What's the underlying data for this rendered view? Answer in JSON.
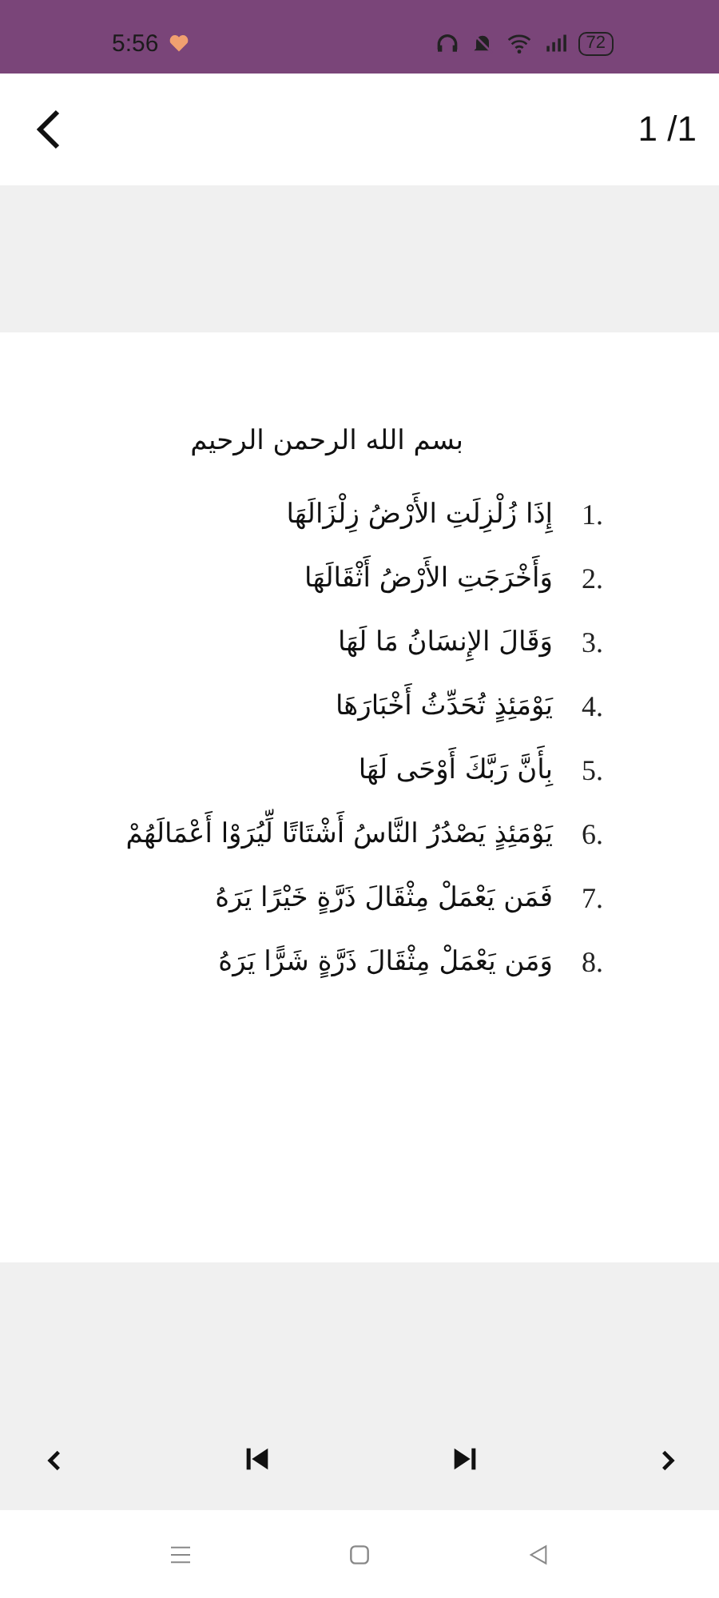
{
  "status_bar": {
    "time": "5:56",
    "battery": "72"
  },
  "header": {
    "page_indicator": "1 /1"
  },
  "surah": {
    "basmala": "بسم الله الرحمن الرحيم",
    "verses": [
      {
        "number": "1.",
        "text": "إِذَا زُلْزِلَتِ الأَرْضُ زِلْزَالَهَا"
      },
      {
        "number": "2.",
        "text": "وَأَخْرَجَتِ الأَرْضُ أَثْقَالَهَا"
      },
      {
        "number": "3.",
        "text": "وَقَالَ الإِنسَانُ مَا لَهَا"
      },
      {
        "number": "4.",
        "text": "يَوْمَئِذٍ تُحَدِّثُ أَخْبَارَهَا"
      },
      {
        "number": "5.",
        "text": "بِأَنَّ رَبَّكَ أَوْحَى لَهَا"
      },
      {
        "number": "6.",
        "text": "يَوْمَئِذٍ يَصْدُرُ النَّاسُ أَشْتَاتًا لِّيُرَوْا أَعْمَالَهُمْ"
      },
      {
        "number": "7.",
        "text": "فَمَن يَعْمَلْ مِثْقَالَ ذَرَّةٍ خَيْرًا يَرَهُ"
      },
      {
        "number": "8.",
        "text": "وَمَن يَعْمَلْ مِثْقَالَ ذَرَّةٍ شَرًّا يَرَهُ"
      }
    ]
  }
}
